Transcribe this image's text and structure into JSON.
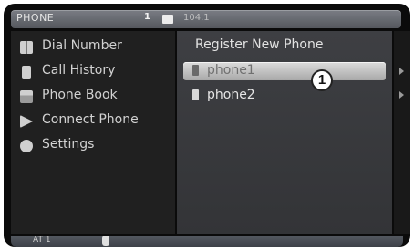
{
  "topbar": {
    "title": "PHONE",
    "signal": "1",
    "frequency": "104.1"
  },
  "sidebar": {
    "items": [
      {
        "label": "Dial Number",
        "icon": "dial-pad-icon"
      },
      {
        "label": "Call History",
        "icon": "call-history-icon"
      },
      {
        "label": "Phone Book",
        "icon": "phone-book-icon"
      },
      {
        "label": "Connect Phone",
        "icon": "connect-phone-icon"
      },
      {
        "label": "Settings",
        "icon": "settings-gear-icon"
      }
    ]
  },
  "main": {
    "header": "Register New Phone",
    "phones": [
      {
        "label": "phone1",
        "selected": true
      },
      {
        "label": "phone2",
        "selected": false
      }
    ]
  },
  "callout": {
    "number": "1"
  },
  "status": {
    "left": "AT 1",
    "icons": [
      "antenna-icon",
      "bluetooth-icon"
    ]
  }
}
